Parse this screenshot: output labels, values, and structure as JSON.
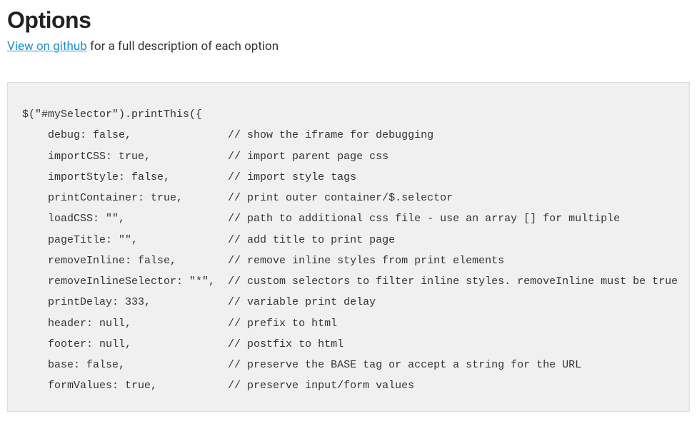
{
  "heading": "Options",
  "link_text": "View on github",
  "subtitle_rest": " for a full description of each option",
  "code": "$(\"#mySelector\").printThis({\n    debug: false,               // show the iframe for debugging\n    importCSS: true,            // import parent page css\n    importStyle: false,         // import style tags\n    printContainer: true,       // print outer container/$.selector\n    loadCSS: \"\",                // path to additional css file - use an array [] for multiple\n    pageTitle: \"\",              // add title to print page\n    removeInline: false,        // remove inline styles from print elements\n    removeInlineSelector: \"*\",  // custom selectors to filter inline styles. removeInline must be true\n    printDelay: 333,            // variable print delay\n    header: null,               // prefix to html\n    footer: null,               // postfix to html\n    base: false,                // preserve the BASE tag or accept a string for the URL\n    formValues: true,           // preserve input/form values"
}
